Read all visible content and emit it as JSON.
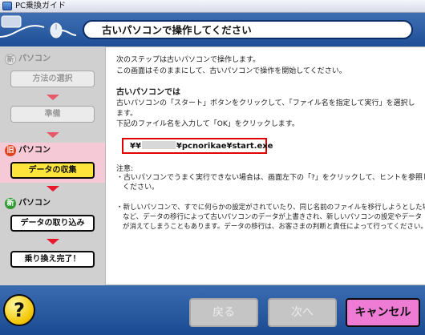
{
  "window": {
    "title": "PC乗換ガイド"
  },
  "header": {
    "title": "古いパソコンで操作してください"
  },
  "sidebar": {
    "new_section_1": {
      "badge": "新",
      "label": "パソコン"
    },
    "step_method": "方法の選択",
    "step_prepare": "準備",
    "old_section": {
      "badge": "旧",
      "label": "パソコン"
    },
    "step_collect": "データの収集",
    "new_section_2": {
      "badge": "新",
      "label": "パソコン"
    },
    "step_import": "データの取り込み",
    "step_complete": "乗り換え完了！"
  },
  "content": {
    "intro_line1": "次のステップは古いパソコンで操作します。",
    "intro_line2": "この画面はそのままにして、古いパソコンで操作を開始してください。",
    "old_pc_heading": "古いパソコンでは",
    "instr_line1": "古いパソコンの「スタート」ボタンをクリックして、「ファイル名を指定して実行」を選択し",
    "instr_line2": "ます。",
    "instr_line3": "下記のファイル名を入力して「OK」をクリックします。",
    "path_prefix": "¥¥",
    "path_suffix": "¥pcnorikae¥start.exe",
    "note_label": "注意:",
    "note1_line1": "・古いパソコンでうまく実行できない場合は、画面左下の「?」をクリックして、ヒントを参照して",
    "note1_line2": "ください。",
    "note2_line1": "・新しいパソコンで、すでに何らかの設定がされていたり、同じ名前のファイルを移行しようとした場合",
    "note2_line2": "など、データの移行によって古いパソコンのデータが上書きされ、新しいパソコンの設定やデータ",
    "note2_line3": "が消えてしまうこともあります。データの移行は、お客さまの判断と責任によって行ってください。"
  },
  "footer": {
    "help_label": "?",
    "back_label": "戻る",
    "next_label": "次へ",
    "cancel_label": "キャンセル"
  },
  "colors": {
    "header_blue": "#2a5aa0",
    "active_step": "#ffe43b",
    "old_band": "#f5c9d6",
    "path_border": "#e00000",
    "cancel_button": "#ee7bd4"
  },
  "icons": {
    "app": "app-icon",
    "header_decoration": "cable-mouse-icon",
    "help": "question-icon"
  }
}
